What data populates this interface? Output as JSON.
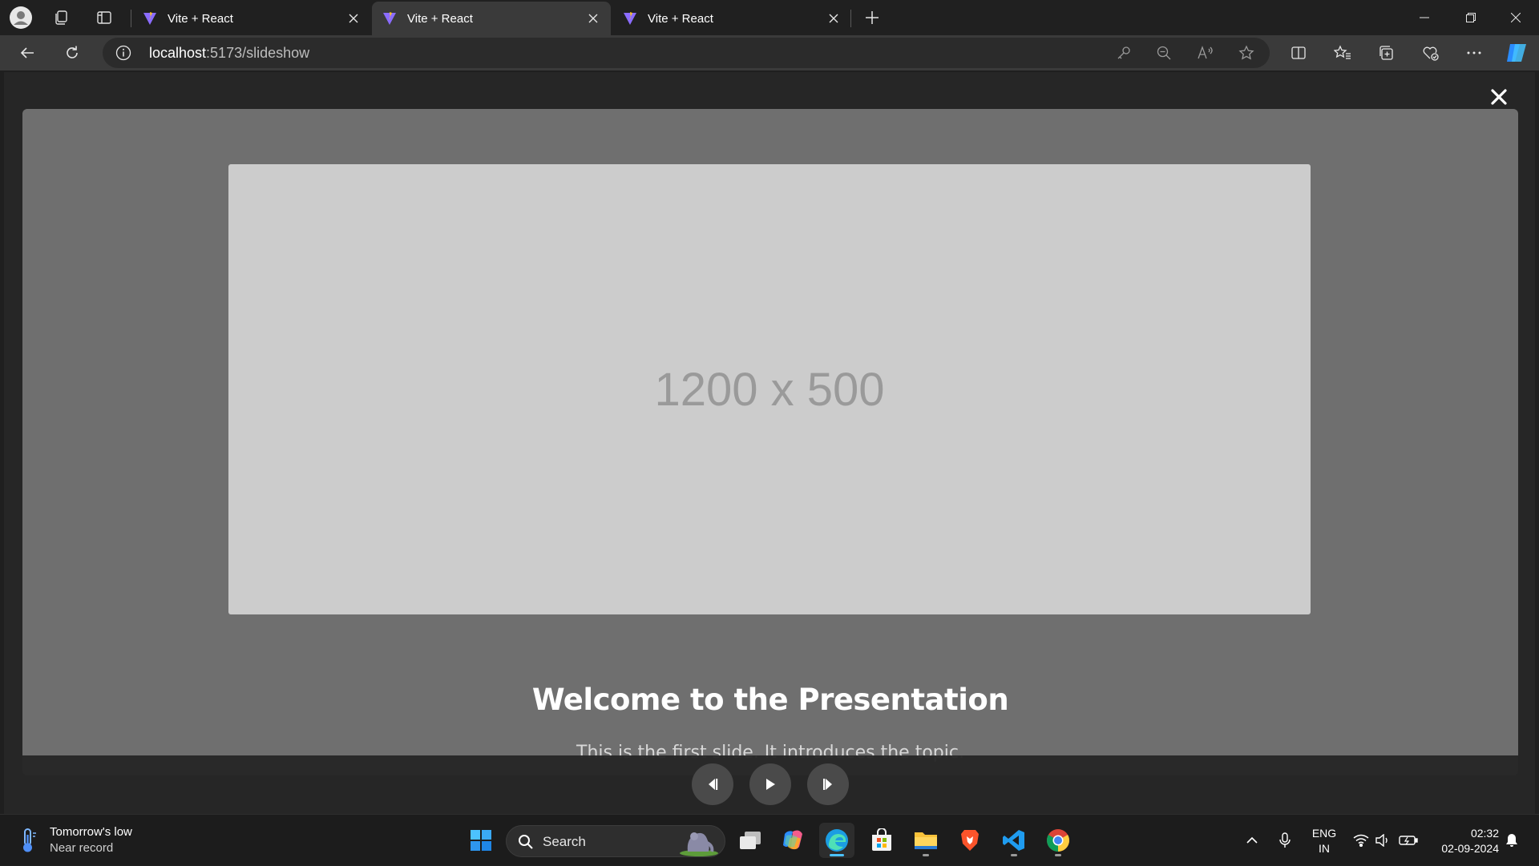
{
  "browser": {
    "tabs": [
      {
        "title": "Vite + React",
        "active": false
      },
      {
        "title": "Vite + React",
        "active": true
      },
      {
        "title": "Vite + React",
        "active": false
      }
    ],
    "address": {
      "host": "localhost",
      "rest": ":5173/slideshow"
    }
  },
  "slideshow": {
    "placeholder_text": "1200 x 500",
    "title": "Welcome to the Presentation",
    "description": "This is the first slide. It introduces the topic."
  },
  "taskbar": {
    "weather_line1": "Tomorrow's low",
    "weather_line2": "Near record",
    "search_label": "Search",
    "lang_line1": "ENG",
    "lang_line2": "IN",
    "time": "02:32",
    "date": "02-09-2024"
  },
  "colors": {
    "accent": "#4cc2ff",
    "slide_bg": "#6f6f6f",
    "placeholder_bg": "#cccccc"
  }
}
